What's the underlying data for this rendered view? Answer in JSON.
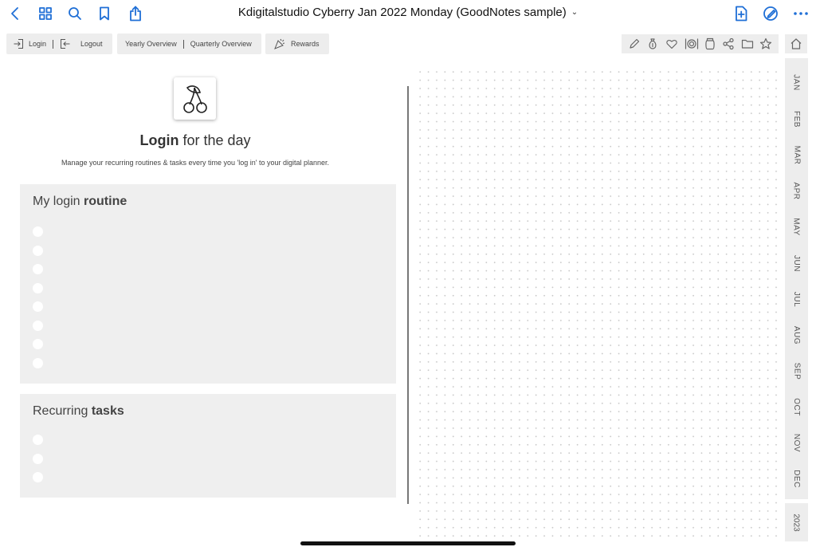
{
  "app": {
    "title": "Kdigitalstudio Cyberry Jan 2022 Monday (GoodNotes sample)",
    "title_chevron": "⌄",
    "accent_color": "#1f6fd6",
    "left_icons": [
      "back-icon",
      "grid-icon",
      "search-icon",
      "bookmark-icon",
      "share-icon"
    ],
    "right_icons": [
      "add-page-icon",
      "pen-mode-icon",
      "more-icon"
    ]
  },
  "nav": {
    "login": "Login",
    "logout": "Logout",
    "yearly": "Yearly Overview",
    "quarterly": "Quarterly Overview",
    "rewards": "Rewards"
  },
  "toolstrip_icons": [
    "pencil-icon",
    "money-bag-icon",
    "heart-icon",
    "meal-icon",
    "jar-icon",
    "share-nodes-icon",
    "folder-icon",
    "star-icon"
  ],
  "page": {
    "title_bold": "Login",
    "title_rest": " for the day",
    "subtitle": "Manage your recurring routines & tasks every time you 'log in' to your digital planner.",
    "routine_heading": "My login ",
    "routine_heading_bold": "routine",
    "routine_items": 8,
    "tasks_heading": "Recurring ",
    "tasks_heading_bold": "tasks",
    "tasks_items": 3
  },
  "months": [
    "JAN",
    "FEB",
    "MAR",
    "APR",
    "MAY",
    "JUN",
    "JUL",
    "AUG",
    "SEP",
    "OCT",
    "NOV",
    "DEC"
  ],
  "year": "2023"
}
